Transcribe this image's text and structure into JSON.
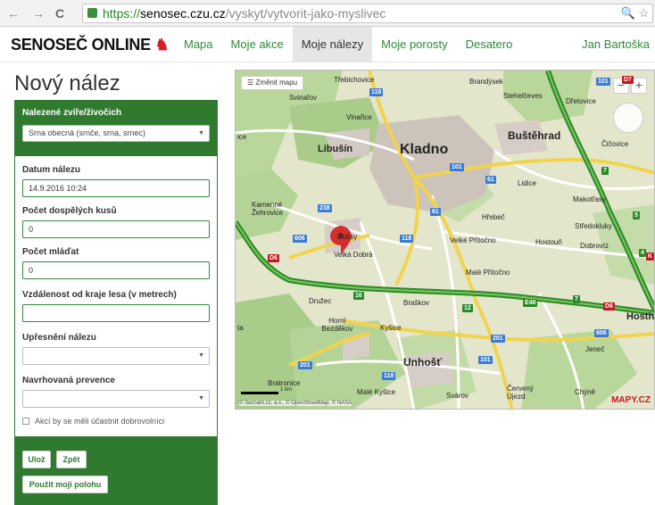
{
  "browser": {
    "url_https": "https://",
    "url_host": "senosec.czu.cz",
    "url_path": "/vyskyt/vytvorit-jako-myslivec",
    "back_glyph": "←",
    "forward_glyph": "→",
    "reload_glyph": "C",
    "right_icons": "🔍 ☆"
  },
  "brand": {
    "logo_text": "SENOSEČ ONLINE",
    "logo_mark": "♞",
    "accent": "#2f7a2f",
    "link": "#2f8a3a",
    "logo_red": "#d81f26"
  },
  "nav": {
    "items": [
      {
        "label": "Mapa",
        "active": false
      },
      {
        "label": "Moje akce",
        "active": false
      },
      {
        "label": "Moje nálezy",
        "active": true
      },
      {
        "label": "Moje porosty",
        "active": false
      },
      {
        "label": "Desatero",
        "active": false
      }
    ],
    "user": "Jan Bartoška"
  },
  "page": {
    "title": "Nový nález"
  },
  "form": {
    "animal_label": "Nalezené zvíře/živočich",
    "animal_value": "Srna obecná (srnče, srna, srnec)",
    "date_label": "Datum nálezu",
    "date_value": "14.9.2016 10:24",
    "adults_label": "Počet dospělých kusů",
    "adults_value": "0",
    "young_label": "Počet mláďat",
    "young_value": "0",
    "distance_label": "Vzdálenost od kraje lesa (v metrech)",
    "distance_value": "",
    "detail_label": "Upřesnění nálezu",
    "detail_value": "",
    "prevention_label": "Navrhovaná prevence",
    "prevention_value": "",
    "volunteers_label": "Akcí by se měli účastnit dobrovolníci",
    "save_button": "Ulož",
    "back_button": "Zpět",
    "location_button": "Použít moji polohu"
  },
  "map": {
    "change_map": "Změnit mapu",
    "zoom_in": "+",
    "zoom_out": "−",
    "copyright": "© Seznam.cz, a.s., © OpenStreetMap, © NASA",
    "scale": "1 km",
    "provider": "MAPY.CZ",
    "places": {
      "kladno": "Kladno",
      "libusin": "Libušín",
      "bustehrad": "Buštěhrad",
      "unhost": "Unhošť",
      "velka_dobra": "Velká Dobrá",
      "doksy": "Doksy",
      "svinarov": "Svinařov",
      "vinarice": "Vinařice",
      "trebichovice": "Třebichovice",
      "brandysek": "Brandýsek",
      "stehelceves": "Stehelčeves",
      "dretovice": "Dřetovice",
      "cicovice": "Čičovice",
      "lidice": "Lidice",
      "makotrasy": "Makotřasy",
      "hrebec": "Hřebeč",
      "stredokluky": "Středokluky",
      "velke_pritocno": "Velké Přítočno",
      "hostoun": "Hostouň",
      "dobroviz": "Dobrovíz",
      "male_pritocno": "Malé Přítočno",
      "druzec": "Družec",
      "braskov": "Braškov",
      "horni_bezdekov": "Horní Bezděkov",
      "kysice": "Kyšice",
      "jenec": "Jeneč",
      "hostivice": "Hostiv",
      "kamenne_zehrovice": "Kamenné Žehrovice",
      "svarov": "Svárov",
      "cerveny_ujezd": "Červený Újezd",
      "chyne": "Chýně",
      "male_kysice": "Malé Kyšice",
      "bratronice": "Bratronice",
      "ice": "ice",
      "ta": "ta"
    },
    "road_badges": {
      "r118a": "118",
      "r101a": "101",
      "r61": "61",
      "r238": "238",
      "r61b": "61",
      "r606": "606",
      "r118b": "118",
      "r201": "201",
      "r101b": "101",
      "r118c": "118",
      "r201b": "201",
      "r606b": "606",
      "d6a": "D6",
      "d6b": "D6",
      "d7": "D7",
      "e48": "E48",
      "r101top": "101",
      "n16": "16",
      "n12": "12",
      "n7a": "7",
      "n7b": "7",
      "n5": "5",
      "n4": "4",
      "k": "K"
    }
  }
}
